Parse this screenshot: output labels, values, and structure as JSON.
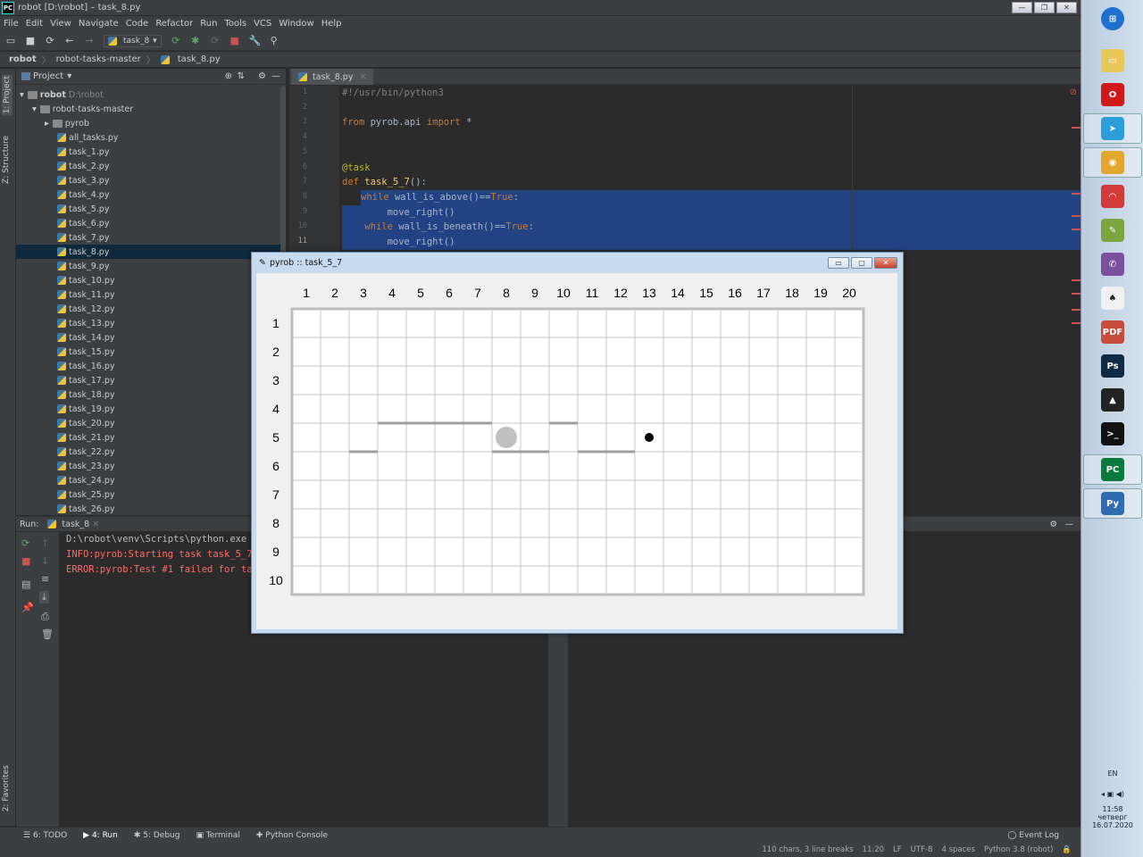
{
  "window": {
    "title": "robot [D:\\robot] – task_8.py",
    "min": "—",
    "max": "❐",
    "close": "✕"
  },
  "menu": [
    "File",
    "Edit",
    "View",
    "Navigate",
    "Code",
    "Refactor",
    "Run",
    "Tools",
    "VCS",
    "Window",
    "Help"
  ],
  "toolbar": {
    "run_config": "task_8"
  },
  "breadcrumb": [
    "robot",
    "robot-tasks-master",
    "task_8.py"
  ],
  "left_stripe": {
    "project": "1: Project",
    "structure": "Z: Structure",
    "favorites": "2: Favorites"
  },
  "project": {
    "header": "Project",
    "root": "robot",
    "root_path": "D:\\robot",
    "folder": "robot-tasks-master",
    "subfolder": "pyrob",
    "files": [
      "all_tasks.py",
      "task_1.py",
      "task_2.py",
      "task_3.py",
      "task_4.py",
      "task_5.py",
      "task_6.py",
      "task_7.py",
      "task_8.py",
      "task_9.py",
      "task_10.py",
      "task_11.py",
      "task_12.py",
      "task_13.py",
      "task_14.py",
      "task_15.py",
      "task_16.py",
      "task_17.py",
      "task_18.py",
      "task_19.py",
      "task_20.py",
      "task_21.py",
      "task_22.py",
      "task_23.py",
      "task_24.py",
      "task_25.py",
      "task_26.py"
    ],
    "selected": "task_8.py"
  },
  "editor": {
    "tab": "task_8.py",
    "line_numbers": [
      "1",
      "2",
      "3",
      "4",
      "5",
      "6",
      "7",
      "8",
      "9",
      "10",
      "11"
    ],
    "lines": [
      {
        "parts": [
          [
            "cm",
            "#!/usr/bin/python3"
          ]
        ]
      },
      {
        "parts": []
      },
      {
        "parts": [
          [
            "kw",
            "from "
          ],
          [
            "",
            "pyrob.api "
          ],
          [
            "kw",
            "import "
          ],
          [
            "",
            "*"
          ]
        ]
      },
      {
        "parts": []
      },
      {
        "parts": []
      },
      {
        "parts": [
          [
            "dec",
            "@task"
          ]
        ]
      },
      {
        "parts": [
          [
            "kw",
            "def "
          ],
          [
            "fn",
            "task_5_7"
          ],
          [
            "",
            "():"
          ]
        ]
      },
      {
        "parts": [
          [
            "",
            "    "
          ],
          [
            "kw",
            "while "
          ],
          [
            "",
            "wall_is_above()=="
          ],
          [
            "kw",
            "True"
          ],
          [
            "",
            ":"
          ]
        ],
        "hl": true
      },
      {
        "parts": [
          [
            "",
            "        move_right()"
          ]
        ],
        "hl": true
      },
      {
        "parts": [
          [
            "",
            "    "
          ],
          [
            "kw",
            "while "
          ],
          [
            "",
            "wall_is_beneath()=="
          ],
          [
            "kw",
            "True"
          ],
          [
            "",
            ":"
          ]
        ],
        "hl": true
      },
      {
        "parts": [
          [
            "",
            "        move_right()"
          ]
        ],
        "hl": true
      }
    ]
  },
  "run": {
    "label": "Run:",
    "tab": "task_8",
    "lines": [
      {
        "text": "D:\\robot\\venv\\Scripts\\python.exe",
        "color": "#bbbbbb"
      },
      {
        "text": "INFO:pyrob:Starting task task_5_7",
        "color": "#ff6b68"
      },
      {
        "text": "ERROR:pyrob:Test #1 failed for ta",
        "color": "#ff6b68"
      }
    ]
  },
  "bottom_tabs": [
    "6: TODO",
    "4: Run",
    "5: Debug",
    "Terminal",
    "Python Console"
  ],
  "event_log": "Event Log",
  "status": [
    "110 chars, 3 line breaks",
    "11:20",
    "LF",
    "UTF-8",
    "4 spaces",
    "Python 3.8 (robot)"
  ],
  "pyrob": {
    "title": "pyrob :: task_5_7",
    "cols": [
      "1",
      "2",
      "3",
      "4",
      "5",
      "6",
      "7",
      "8",
      "9",
      "10",
      "11",
      "12",
      "13",
      "14",
      "15",
      "16",
      "17",
      "18",
      "19",
      "20"
    ],
    "rows": [
      "1",
      "2",
      "3",
      "4",
      "5",
      "6",
      "7",
      "8",
      "9",
      "10"
    ],
    "walls_horizontal": [
      {
        "between_rows": [
          4,
          5
        ],
        "col": 4
      },
      {
        "between_rows": [
          4,
          5
        ],
        "col": 5
      },
      {
        "between_rows": [
          4,
          5
        ],
        "col": 6
      },
      {
        "between_rows": [
          4,
          5
        ],
        "col": 7
      },
      {
        "between_rows": [
          4,
          5
        ],
        "col": 10
      },
      {
        "between_rows": [
          5,
          6
        ],
        "col": 3
      },
      {
        "between_rows": [
          5,
          6
        ],
        "col": 8
      },
      {
        "between_rows": [
          5,
          6
        ],
        "col": 9
      },
      {
        "between_rows": [
          5,
          6
        ],
        "col": 11
      },
      {
        "between_rows": [
          5,
          6
        ],
        "col": 12
      }
    ],
    "robot": {
      "row": 5,
      "col": 8
    },
    "target": {
      "row": 5,
      "col": 13
    },
    "colors": {
      "grid": "#c8c8c8",
      "wall": "#a0a0a0",
      "robot": "#c0c0c0",
      "target": "#000000"
    }
  },
  "taskbar": {
    "icons": [
      "windows-start",
      "folder",
      "opera",
      "telegram",
      "chrome",
      "headphones",
      "notepad",
      "viber",
      "solitaire",
      "pdf",
      "photoshop",
      "vlc-like",
      "cmd",
      "pycharm",
      "python"
    ],
    "lang": "EN",
    "time": "11:58",
    "day": "четверг",
    "date": "16.07.2020"
  }
}
